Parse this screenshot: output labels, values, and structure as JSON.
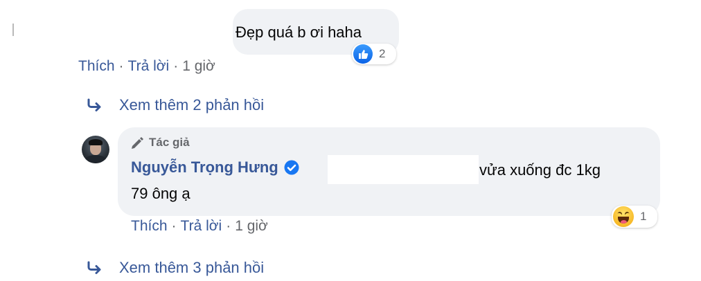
{
  "comment_top": {
    "text": "Đẹp quá b ơi haha",
    "reaction": {
      "icon": "like-icon",
      "count": "2"
    },
    "actions": {
      "like": "Thích",
      "reply": "Trả lời",
      "time": "1 giờ",
      "separator": "·"
    }
  },
  "more_replies_1": {
    "label": "Xem thêm 2 phản hồi",
    "icon": "reply-arrow-icon"
  },
  "author_reply": {
    "badge": "Tác giả",
    "badge_icon": "pencil-icon",
    "author": "Nguyễn Trọng Hưng",
    "verified_icon": "verified-check-icon",
    "text_line1": "vửa xuống đc 1kg",
    "text_line2": "79 ông ạ",
    "reaction": {
      "icon": "haha-icon",
      "count": "1"
    },
    "actions": {
      "like": "Thích",
      "reply": "Trả lời",
      "time": "1 giờ",
      "separator": "·"
    }
  },
  "more_replies_2": {
    "label": "Xem thêm 3 phản hồi",
    "icon": "reply-arrow-icon"
  },
  "colors": {
    "link_blue": "#385898",
    "bubble_gray": "#f0f2f5",
    "meta_gray": "#65676b",
    "like_blue": "#1877f2",
    "haha_yellow": "#f7b928"
  }
}
